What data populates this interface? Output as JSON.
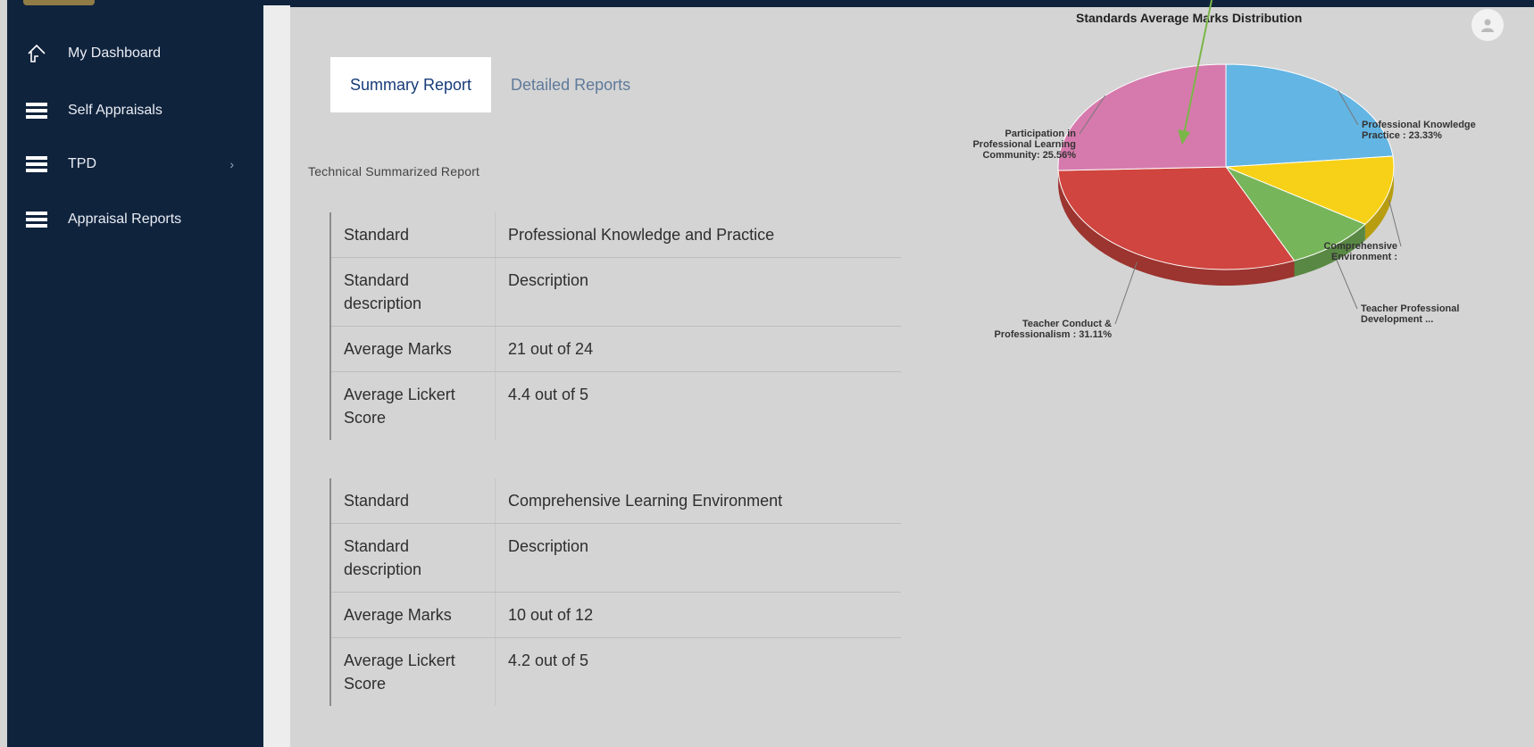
{
  "sidebar": {
    "items": [
      {
        "label": "My Dashboard",
        "icon": "home-icon"
      },
      {
        "label": "Self Appraisals",
        "icon": "list-icon",
        "chevron": ""
      },
      {
        "label": "TPD",
        "icon": "list-icon",
        "chevron": "›"
      },
      {
        "label": "Appraisal Reports",
        "icon": "list-icon",
        "chevron": ""
      }
    ]
  },
  "tabs": [
    {
      "label": "Summary Report",
      "active": true
    },
    {
      "label": "Detailed Reports",
      "active": false
    }
  ],
  "report_title": "Technical Summarized Report",
  "standards": [
    {
      "standard_label": "Standard",
      "standard": "Professional Knowledge and Practice",
      "description_label": "Standard description",
      "description": "Description",
      "avg_marks_label": "Average Marks",
      "avg_marks": "21  out of  24",
      "likert_label": "Average Lickert Score",
      "likert": "4.4  out of  5"
    },
    {
      "standard_label": "Standard",
      "standard": "Comprehensive Learning Environment",
      "description_label": "Standard description",
      "description": "Description",
      "avg_marks_label": "Average Marks",
      "avg_marks": "10  out of  12",
      "likert_label": "Average Lickert Score",
      "likert": "4.2  out of  5"
    }
  ],
  "chart_data": {
    "type": "pie",
    "title": "Standards Average Marks Distribution",
    "slices": [
      {
        "name": "Professional Knowledge Practice",
        "label": "Professional Knowledge\nPractice : 23.33%",
        "value": 23.33,
        "color": "#63b5e3"
      },
      {
        "name": "Comprehensive Environment",
        "label": "Comprehensive\nEnvironment :",
        "value": 11.11,
        "color": "#f7d117"
      },
      {
        "name": "Teacher Professional Development",
        "label": "Teacher Professional\nDevelopment ...",
        "value": 8.89,
        "color": "#77b55a"
      },
      {
        "name": "Teacher Conduct & Professionalism",
        "label": "Teacher Conduct &\nProfessionalism : 31.11%",
        "value": 31.11,
        "color": "#d0453f"
      },
      {
        "name": "Participation in Professional Learning Community",
        "label": "Participation in\nProfessional Learning\nCommunity: 25.56%",
        "value": 25.56,
        "color": "#d67aad"
      }
    ]
  },
  "colors": {
    "sidebar": "#10233d",
    "arrow": "#7ab648"
  }
}
